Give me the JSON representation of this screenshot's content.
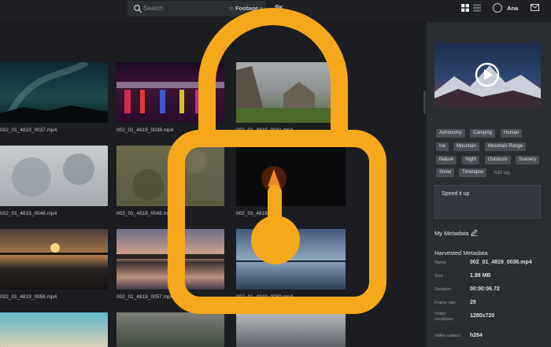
{
  "header": {
    "search_placeholder": "Search",
    "scope_prefix": "in",
    "scope_value": "Footage",
    "user_name": "Ana"
  },
  "grid": {
    "captions": [
      "002_01_4819_0037.mp4",
      "002_01_4819_0038.mp4",
      "002_01_4819_0041.mp4",
      "002_01_4819_0046.mp4",
      "002_01_4819_0048.mp4",
      "002_01_4819_00",
      "002_01_4819_0056.mp4",
      "002_01_4819_0057.mp4",
      "002_01_4819_0059.mp4"
    ]
  },
  "sidebar": {
    "tags": [
      "Astronomy",
      "Camping",
      "Human",
      "Ice",
      "Mountain",
      "Mountain Range",
      "Nature",
      "Night",
      "Outdoors",
      "Scenery",
      "Snow",
      "Timelapse"
    ],
    "add_tag": "Add tag",
    "notes": "Speed it up",
    "my_metadata": "My Metadata",
    "harvested_metadata": "Harvested Metadata",
    "fields": [
      {
        "key": "Name",
        "value": "002_01_4819_0036.mp4"
      },
      {
        "key": "Size",
        "value": "1.98 MB"
      },
      {
        "key": "Duration",
        "value": "00:00:06.72"
      },
      {
        "key": "Frame rate",
        "value": "25"
      },
      {
        "key": "Video resolution",
        "value": "1280x720"
      },
      {
        "key": "Video codecs",
        "value": "h264"
      }
    ]
  },
  "colors": {
    "lock": "#f6a81c",
    "background": "#1b1d21",
    "sidebar": "#2a2d32",
    "tag": "#4a4e55"
  },
  "icons": [
    "search-icon",
    "chevron-down-icon",
    "filter-icon",
    "grid-view-icon",
    "list-view-icon",
    "avatar-icon",
    "mail-icon",
    "play-icon",
    "edit-icon",
    "lock-icon"
  ]
}
